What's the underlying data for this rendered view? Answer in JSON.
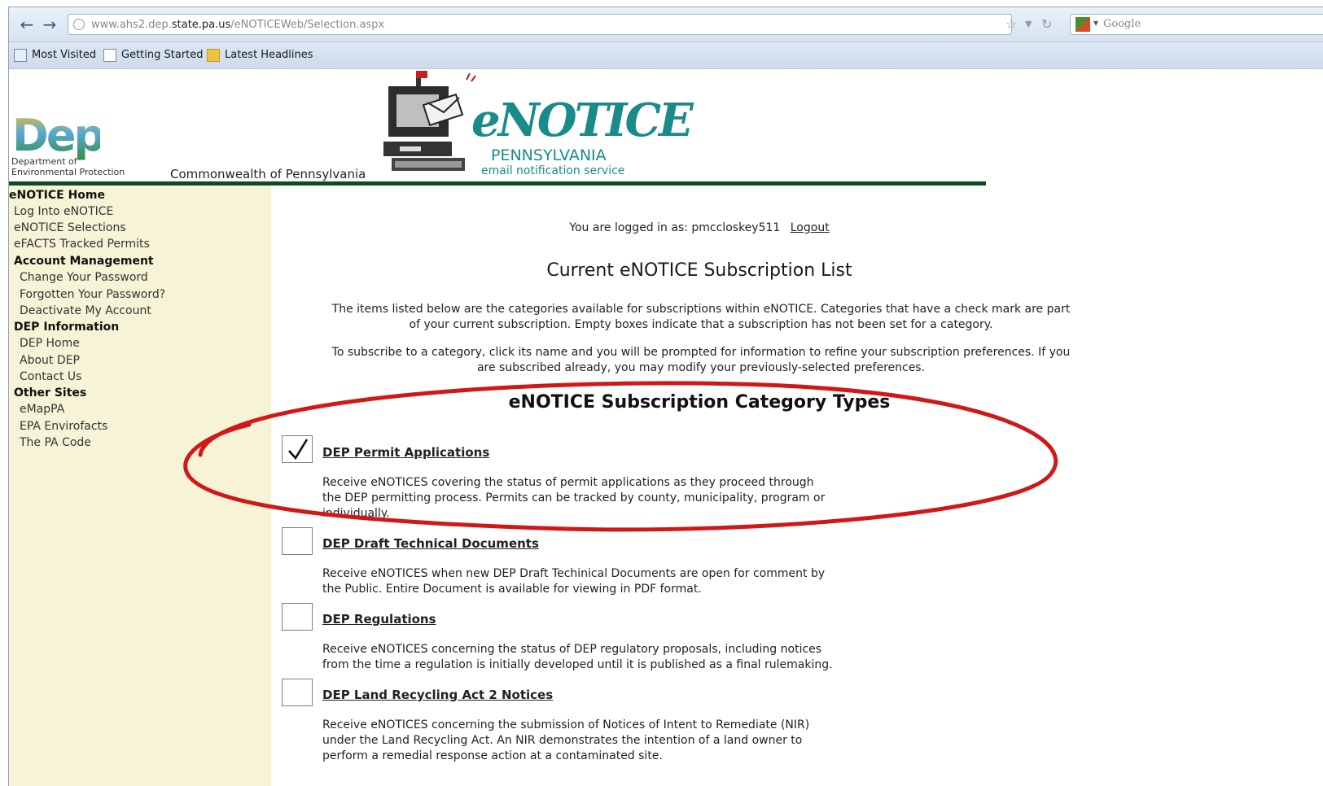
{
  "browser": {
    "url_prefix": "www.ahs2.dep.",
    "url_domain": "state.pa.us",
    "url_path": "/eNOTICEWeb/Selection.aspx",
    "search_placeholder": "Google",
    "bookmarks": [
      {
        "label": "Most Visited"
      },
      {
        "label": "Getting Started"
      },
      {
        "label": "Latest Headlines"
      }
    ]
  },
  "header": {
    "dep_caption_line1": "Department of",
    "dep_caption_line2": "Environmental Protection",
    "commonwealth": "Commonwealth of Pennsylvania",
    "logo_title": "eNOTICE",
    "logo_state": "PENNSYLVANIA",
    "logo_tagline": "email notification service"
  },
  "sidebar": {
    "items": [
      {
        "label": "eNOTICE Home"
      },
      {
        "label": "Log Into eNOTICE"
      },
      {
        "label": "eNOTICE Selections"
      },
      {
        "label": "eFACTS Tracked Permits"
      },
      {
        "label": "Account Management"
      },
      {
        "label": "Change Your Password"
      },
      {
        "label": "Forgotten Your Password?"
      },
      {
        "label": "Deactivate My Account"
      },
      {
        "label": "DEP Information"
      },
      {
        "label": "DEP Home"
      },
      {
        "label": "About DEP"
      },
      {
        "label": "Contact Us"
      },
      {
        "label": "Other Sites"
      },
      {
        "label": "eMapPA"
      },
      {
        "label": "EPA Envirofacts"
      },
      {
        "label": "The PA Code"
      }
    ]
  },
  "main": {
    "logged_in_text": "You are logged in as: pmccloskey511",
    "logout_label": "Logout",
    "list_title": "Current eNOTICE Subscription List",
    "intro1_line1": "The items listed below are the categories available for subscriptions within eNOTICE. Categories that have a check mark are part",
    "intro1_line2": "of your current subscription. Empty boxes indicate that a subscription has not been set for a category.",
    "intro2_line1": "To subscribe to a category, click its name and you will be prompted for information to refine your subscription preferences. If you",
    "intro2_line2": "are subscribed already, you may modify your previously-selected preferences.",
    "category_title": "eNOTICE Subscription Category Types",
    "categories": [
      {
        "name": "DEP Permit Applications",
        "checked": true,
        "desc1": "Receive eNOTICES covering the status of permit applications as they proceed through",
        "desc2": "the DEP permitting process. Permits can be tracked by county, municipality, program or",
        "desc3": "individually."
      },
      {
        "name": "DEP Draft Technical Documents",
        "checked": false,
        "desc1": "Receive eNOTICES when new DEP Draft Techinical Documents are open for comment by",
        "desc2": "the Public. Entire Document is available for viewing in PDF format."
      },
      {
        "name": "DEP Regulations",
        "checked": false,
        "desc1": "Receive eNOTICES concerning the status of DEP regulatory proposals, including notices",
        "desc2": "from the time a regulation is initially developed until it is published as a final rulemaking."
      },
      {
        "name": "DEP Land Recycling Act 2 Notices",
        "checked": false,
        "desc1": "Receive eNOTICES concerning the submission of Notices of Intent to Remediate (NIR)",
        "desc2": "under the Land Recycling Act. An NIR demonstrates the intention of a land owner to",
        "desc3": "perform a remedial response action at a contaminated site."
      }
    ]
  },
  "colors": {
    "sidebar_bg": "#f6f3d6",
    "header_rule": "#0f4a24",
    "logo_teal": "#1a8a8a",
    "annotation_red": "#d01818"
  }
}
